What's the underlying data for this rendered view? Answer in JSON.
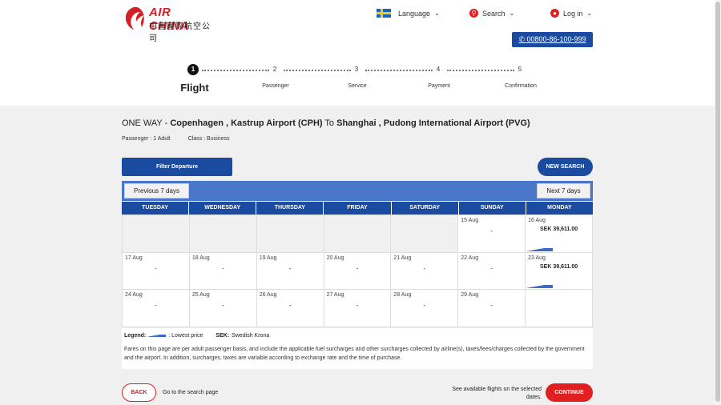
{
  "brand": {
    "name_en": "AIR CHINA",
    "name_cn": "中國國際航空公司",
    "accent": "#d41f26",
    "primary": "#1b4ba0"
  },
  "topnav": {
    "language": "Language",
    "search": "Search",
    "login": "Log in",
    "phone": "00800-86-100-999"
  },
  "steps": [
    {
      "num": "1",
      "label": "Flight"
    },
    {
      "num": "2",
      "label": "Passenger"
    },
    {
      "num": "3",
      "label": "Service"
    },
    {
      "num": "4",
      "label": "Payment"
    },
    {
      "num": "5",
      "label": "Confirmation"
    }
  ],
  "route": {
    "trip_type": "ONE WAY",
    "separator": " - ",
    "origin": "Copenhagen , Kastrup Airport (CPH)",
    "to": " To ",
    "destination": "Shanghai , Pudong International Airport (PVG)"
  },
  "passenger": {
    "pax": "Passenger : 1 Adult",
    "cabin": "Class : Business"
  },
  "buttons": {
    "filter": "Filter Departure",
    "new_search": "NEW SEARCH",
    "prev": "Previous 7 days",
    "next": "Next 7 days",
    "back": "BACK",
    "continue": "CONTINUE"
  },
  "weekdays": [
    "TUESDAY",
    "WEDNESDAY",
    "THURSDAY",
    "FRIDAY",
    "SATURDAY",
    "SUNDAY",
    "MONDAY"
  ],
  "calendar": [
    [
      {
        "date": "",
        "price": ""
      },
      {
        "date": "",
        "price": ""
      },
      {
        "date": "",
        "price": ""
      },
      {
        "date": "",
        "price": ""
      },
      {
        "date": "",
        "price": ""
      },
      {
        "date": "15 Aug",
        "price": "-"
      },
      {
        "date": "16 Aug",
        "price": "SEK 39,611.00",
        "lowest": true
      }
    ],
    [
      {
        "date": "17 Aug",
        "price": "-"
      },
      {
        "date": "18 Aug",
        "price": "-"
      },
      {
        "date": "19 Aug",
        "price": "-"
      },
      {
        "date": "20 Aug",
        "price": "-"
      },
      {
        "date": "21 Aug",
        "price": "-"
      },
      {
        "date": "22 Aug",
        "price": "-"
      },
      {
        "date": "23 Aug",
        "price": "SEK 39,611.00",
        "lowest": true
      }
    ],
    [
      {
        "date": "24 Aug",
        "price": "-"
      },
      {
        "date": "25 Aug",
        "price": "-"
      },
      {
        "date": "26 Aug",
        "price": "-"
      },
      {
        "date": "27 Aug",
        "price": "-"
      },
      {
        "date": "28 Aug",
        "price": "-"
      },
      {
        "date": "29 Aug",
        "price": "-"
      },
      {
        "date": "",
        "price": "",
        "filler": true
      }
    ]
  ],
  "legend": {
    "title": "Legend:",
    "lowest": ": Lowest price",
    "currency_code": "SEK:",
    "currency_name": "Swedish Krona"
  },
  "notice": "Fares on this page are per adult passenger basis, and include the applicable fuel surcharges and other surcharges collected by airline(s), taxes/fees/charges collected by the government and the airport. In addition, surcharges, taxes are variable according to exchange rate and the time of purchase.",
  "footer": {
    "back_text": "Go to the search page",
    "avail_text": "See available flights on the selected dates."
  }
}
